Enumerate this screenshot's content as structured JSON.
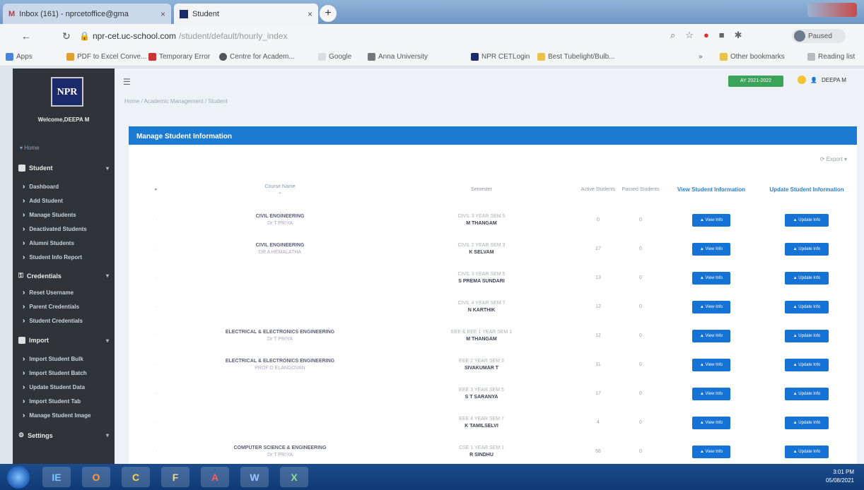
{
  "browser": {
    "tabs": [
      {
        "title": "Inbox (161) - nprcetoffice@gma",
        "active": false
      },
      {
        "title": "Student",
        "active": true
      }
    ],
    "new_tab": "+",
    "url": "npr-cet.uc-school.com",
    "url_path": "/student/default/hourly_index",
    "profile_label": "Paused",
    "bookmarks": [
      "Apps",
      "PDF to Excel Conve...",
      "Temporary Error",
      "Centre for Academ...",
      "Google",
      "Anna University",
      "NPR CETLogin",
      "Best Tubelight/Bulb...",
      "Other bookmarks",
      "Reading list"
    ],
    "bookmarks_more": "»"
  },
  "sidebar": {
    "logo_text": "NPR",
    "welcome": "Welcome,DEEPA M",
    "home": "Home",
    "sections": [
      {
        "label": "Student",
        "items": [
          "Dashboard",
          "Add Student",
          "Manage Students",
          "Deactivated Students",
          "Alumni Students",
          "Student Info Report"
        ]
      },
      {
        "label": "Credentials",
        "items": [
          "Reset Username",
          "Parent Credentials",
          "Student Credentials"
        ]
      },
      {
        "label": "Import",
        "items": [
          "Import Student Bulk",
          "Import Student Batch",
          "Update Student Data",
          "Import Student Tab",
          "Manage Student Image"
        ]
      },
      {
        "label": "Settings",
        "items": []
      }
    ]
  },
  "header": {
    "academic_year": "AY 2021-2022",
    "user": "DEEPA M",
    "breadcrumb": "Home  /  Academic Management  /  Student"
  },
  "panel": {
    "title": "Manage Student Information",
    "export": "Export",
    "columns": {
      "course": "Course Name",
      "semester": "Semester",
      "active": "Active Students",
      "passed": "Passed Students",
      "view": "View Student Information",
      "update": "Update Student Information"
    },
    "view_btn": "View Info",
    "update_btn": "Update Info",
    "rows": [
      {
        "course": "CIVIL ENGINEERING",
        "staff": "Dr T PRIYA",
        "sem": "CIVIL 3 YEAR SEM 5",
        "sem_staff": "M THANGAM",
        "active": "0",
        "passed": "0"
      },
      {
        "course": "CIVIL ENGINEERING",
        "staff": "DR A HEMALATHA",
        "sem": "CIVIL 2 YEAR SEM 3",
        "sem_staff": "K SELVAM",
        "active": "17",
        "passed": "0"
      },
      {
        "course": "",
        "staff": "",
        "sem": "CIVIL 3 YEAR SEM 5",
        "sem_staff": "S PREMA SUNDARI",
        "active": "13",
        "passed": "0"
      },
      {
        "course": "",
        "staff": "",
        "sem": "CIVIL 4 YEAR SEM 7",
        "sem_staff": "N KARTHIK",
        "active": "12",
        "passed": "0"
      },
      {
        "course": "ELECTRICAL & ELECTRONICS ENGINEERING",
        "staff": "Dr T PRIYA",
        "sem": "EEE & EEE 1 YEAR SEM 1",
        "sem_staff": "M THANGAM",
        "active": "12",
        "passed": "0"
      },
      {
        "course": "ELECTRICAL & ELECTRONICS ENGINEERING",
        "staff": "PROF D ELANGOVAN",
        "sem": "EEE 2 YEAR SEM 3",
        "sem_staff": "SIVAKUMAR T",
        "active": "11",
        "passed": "0"
      },
      {
        "course": "",
        "staff": "",
        "sem": "EEE 3 YEAR SEM 5",
        "sem_staff": "S T SARANYA",
        "active": "17",
        "passed": "0"
      },
      {
        "course": "",
        "staff": "",
        "sem": "EEE 4 YEAR SEM 7",
        "sem_staff": "K TAMILSELVI",
        "active": "4",
        "passed": "0"
      },
      {
        "course": "COMPUTER SCIENCE & ENGINEERING",
        "staff": "Dr T PRIYA",
        "sem": "CSE 1 YEAR SEM 1",
        "sem_staff": "R SINDHU",
        "active": "66",
        "passed": "0"
      }
    ]
  },
  "taskbar": {
    "apps": [
      "IE",
      "O",
      "C",
      "F",
      "A",
      "W",
      "X"
    ],
    "time": "3:01 PM",
    "date": "05/08/2021"
  }
}
